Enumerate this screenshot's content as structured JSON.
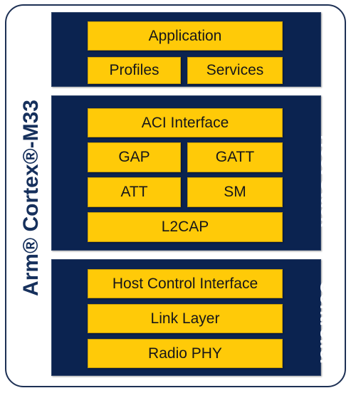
{
  "diagram": {
    "mcu_label": "Arm® Cortex®-M33",
    "sections": {
      "application": {
        "side_label": "",
        "blocks": {
          "application": "Application",
          "profiles": "Profiles",
          "services": "Services"
        }
      },
      "host_stack": {
        "side_label": "Host Stack",
        "blocks": {
          "aci_interface": "ACI Interface",
          "gap": "GAP",
          "gatt": "GATT",
          "att": "ATT",
          "sm": "SM",
          "l2cap": "L2CAP"
        }
      },
      "controller": {
        "side_label": "Controller",
        "blocks": {
          "host_control_interface": "Host Control Interface",
          "link_layer": "Link Layer",
          "radio_phy": "Radio PHY"
        }
      }
    },
    "colors": {
      "navy_panel": "#0b2350",
      "block_yellow": "#FFCA08",
      "block_text": "#16161a",
      "side_label_text": "#ffffff",
      "mcu_label_text": "#16305c",
      "outline": "#1d3054",
      "background": "#ffffff"
    }
  }
}
